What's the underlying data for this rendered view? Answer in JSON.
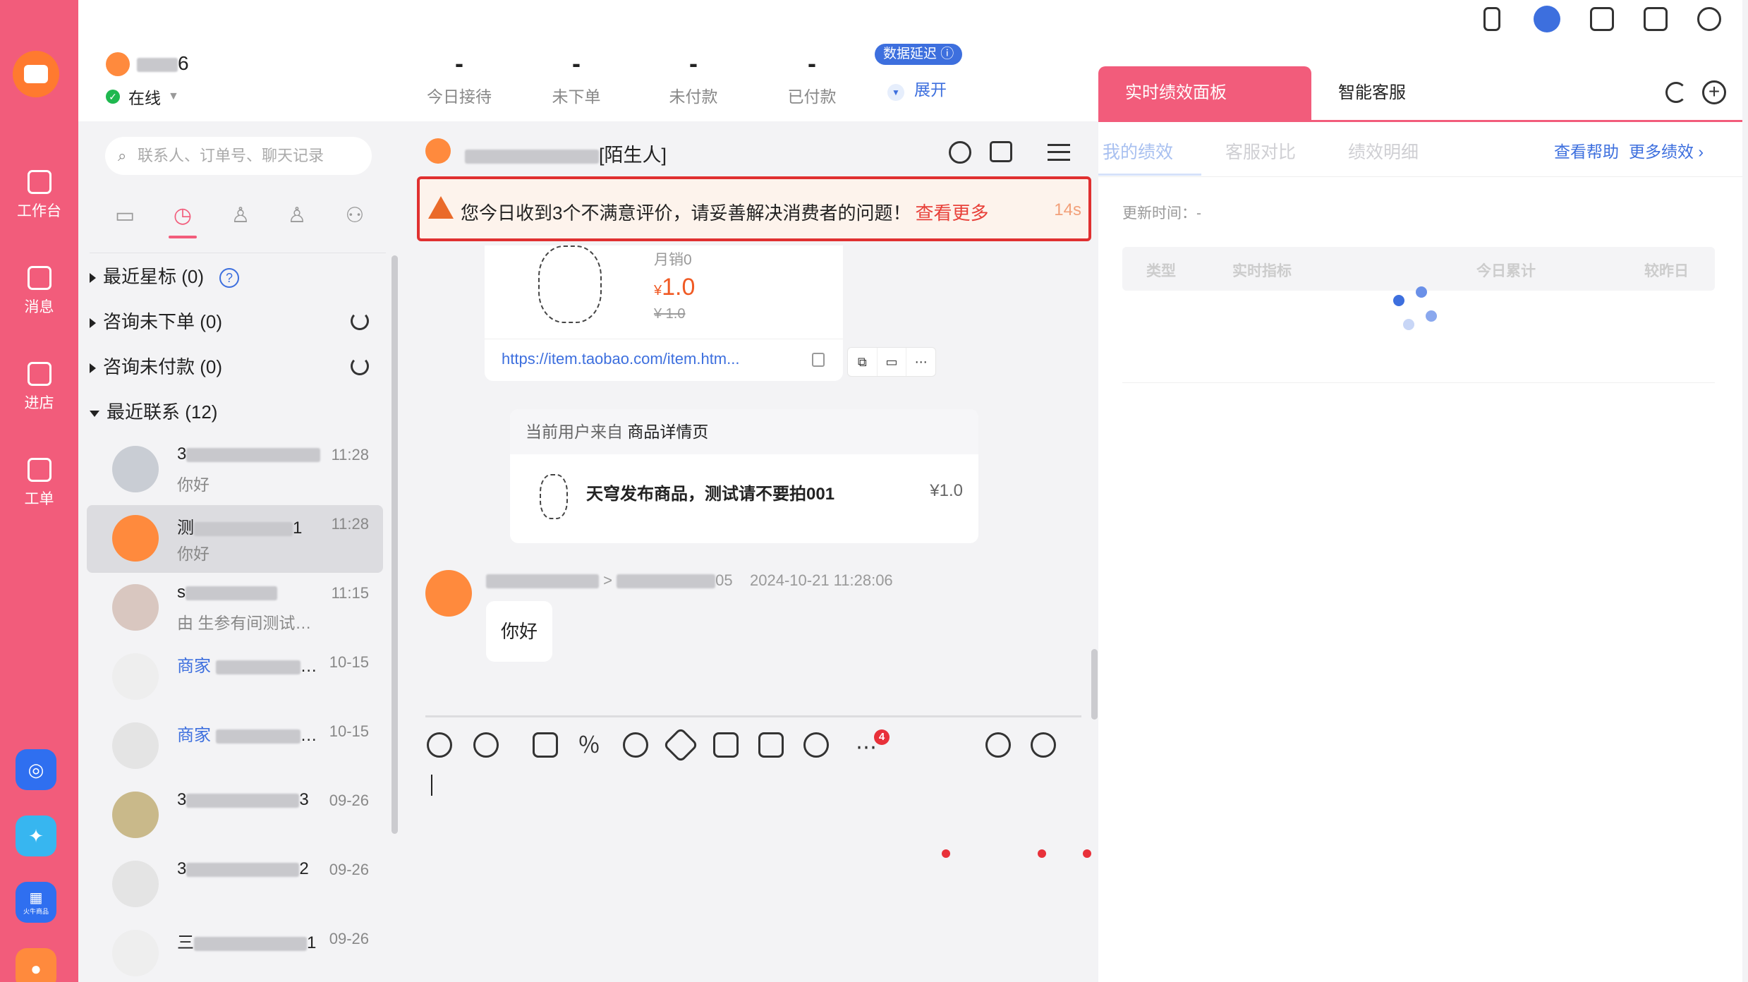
{
  "window": {
    "controls": [
      "close",
      "minimize",
      "zoom"
    ]
  },
  "rail": {
    "items": [
      {
        "label": "工作台",
        "icon": "workbench-icon"
      },
      {
        "label": "消息",
        "icon": "message-icon"
      },
      {
        "label": "进店",
        "icon": "store-icon"
      },
      {
        "label": "工单",
        "icon": "ticket-icon"
      }
    ],
    "apps": [
      {
        "icon": "crown-app-icon",
        "color": "#2f6ff0"
      },
      {
        "icon": "dolphin-app-icon",
        "color": "#37b6f0"
      },
      {
        "icon": "grid-app-icon",
        "color": "#2f6ff0",
        "text": "火牛商品"
      },
      {
        "icon": "duck-app-icon",
        "color": "#ff8a3d"
      }
    ]
  },
  "header": {
    "user_name_suffix": "6",
    "status": "在线",
    "stats": [
      {
        "value": "-",
        "label": "今日接待"
      },
      {
        "value": "-",
        "label": "未下单"
      },
      {
        "value": "-",
        "label": "未付款"
      },
      {
        "value": "-",
        "label": "已付款"
      }
    ],
    "data_delay_badge": "数据延迟",
    "expand": "展开"
  },
  "contacts": {
    "search_placeholder": "联系人、订单号、聊天记录",
    "groups": [
      {
        "label": "最近星标 (0)",
        "expanded": false
      },
      {
        "label": "咨询未下单 (0)",
        "expanded": false
      },
      {
        "label": "咨询未付款 (0)",
        "expanded": false
      },
      {
        "label": "最近联系 (12)",
        "expanded": true
      }
    ],
    "items": [
      {
        "name_start": "3",
        "name_end": "",
        "time": "11:28",
        "message": "你好",
        "selected": false,
        "avatar": "#c9cdd4"
      },
      {
        "name_start": "测",
        "name_end": "1",
        "time": "11:28",
        "message": "你好",
        "selected": true,
        "avatar": "#ff8a3d"
      },
      {
        "name_start": "s",
        "name_end": "",
        "time": "11:15",
        "message": "由 生参有间测试…",
        "selected": false,
        "avatar": "#d9c7c0"
      },
      {
        "name_start": "",
        "name_end": "…",
        "shop": "商家",
        "time": "10-15",
        "message": "",
        "selected": false,
        "avatar": "#eeeeee"
      },
      {
        "name_start": "",
        "name_end": "…",
        "shop": "商家",
        "time": "10-15",
        "message": "",
        "selected": false,
        "avatar": "#e4e4e4"
      },
      {
        "name_start": "3",
        "name_end": "3",
        "time": "09-26",
        "message": "",
        "selected": false,
        "avatar": "#c9b98a"
      },
      {
        "name_start": "3",
        "name_end": "2",
        "time": "09-26",
        "message": "",
        "selected": false,
        "avatar": "#e4e4e4"
      },
      {
        "name_start": "三",
        "name_end": "1",
        "time": "09-26",
        "message": "",
        "selected": false,
        "avatar": "#eeeeee"
      }
    ]
  },
  "chat": {
    "title_suffix": "[陌生人]",
    "alert": {
      "text": "您今日收到3个不满意评价，请妥善解决消费者的问题！",
      "link": "查看更多",
      "countdown": "14s"
    },
    "product_card": {
      "sales": "月销0",
      "price_symbol": "¥",
      "price": "1.0",
      "original_price": "¥ 1.0",
      "url": "https://item.taobao.com/item.htm..."
    },
    "source_card": {
      "prefix": "当前用户来自",
      "page": "商品详情页",
      "product_name": "天穹发布商品，测试请不要拍001",
      "price": "¥1.0"
    },
    "message": {
      "meta_end": "05",
      "time": "2024-10-21 11:28:06",
      "text": "你好"
    },
    "toolbar_badge": "4"
  },
  "right_panel": {
    "tabs": [
      "实时绩效面板",
      "智能客服"
    ],
    "subtabs": [
      "我的绩效",
      "客服对比",
      "绩效明细"
    ],
    "links": [
      "查看帮助",
      "更多绩效"
    ],
    "update_label": "更新时间：-",
    "table_headers": [
      "类型",
      "实时指标",
      "今日累计",
      "较昨日"
    ]
  },
  "colors": {
    "brand": "#f25c7b",
    "accent": "#3d6fde",
    "alert": "#e03030",
    "price": "#f05a24"
  }
}
